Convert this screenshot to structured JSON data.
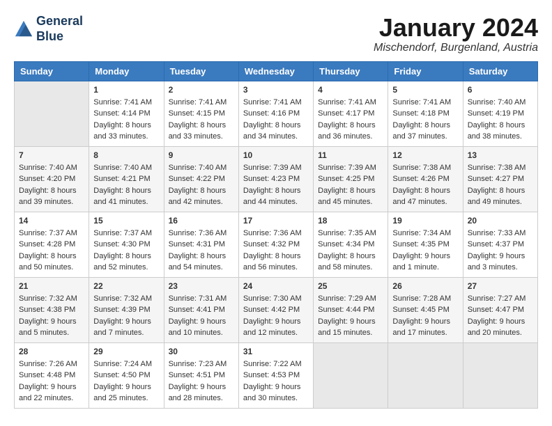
{
  "header": {
    "logo_line1": "General",
    "logo_line2": "Blue",
    "month": "January 2024",
    "location": "Mischendorf, Burgenland, Austria"
  },
  "weekdays": [
    "Sunday",
    "Monday",
    "Tuesday",
    "Wednesday",
    "Thursday",
    "Friday",
    "Saturday"
  ],
  "weeks": [
    [
      {
        "day": "",
        "sunrise": "",
        "sunset": "",
        "daylight": ""
      },
      {
        "day": "1",
        "sunrise": "Sunrise: 7:41 AM",
        "sunset": "Sunset: 4:14 PM",
        "daylight": "Daylight: 8 hours and 33 minutes."
      },
      {
        "day": "2",
        "sunrise": "Sunrise: 7:41 AM",
        "sunset": "Sunset: 4:15 PM",
        "daylight": "Daylight: 8 hours and 33 minutes."
      },
      {
        "day": "3",
        "sunrise": "Sunrise: 7:41 AM",
        "sunset": "Sunset: 4:16 PM",
        "daylight": "Daylight: 8 hours and 34 minutes."
      },
      {
        "day": "4",
        "sunrise": "Sunrise: 7:41 AM",
        "sunset": "Sunset: 4:17 PM",
        "daylight": "Daylight: 8 hours and 36 minutes."
      },
      {
        "day": "5",
        "sunrise": "Sunrise: 7:41 AM",
        "sunset": "Sunset: 4:18 PM",
        "daylight": "Daylight: 8 hours and 37 minutes."
      },
      {
        "day": "6",
        "sunrise": "Sunrise: 7:40 AM",
        "sunset": "Sunset: 4:19 PM",
        "daylight": "Daylight: 8 hours and 38 minutes."
      }
    ],
    [
      {
        "day": "7",
        "sunrise": "Sunrise: 7:40 AM",
        "sunset": "Sunset: 4:20 PM",
        "daylight": "Daylight: 8 hours and 39 minutes."
      },
      {
        "day": "8",
        "sunrise": "Sunrise: 7:40 AM",
        "sunset": "Sunset: 4:21 PM",
        "daylight": "Daylight: 8 hours and 41 minutes."
      },
      {
        "day": "9",
        "sunrise": "Sunrise: 7:40 AM",
        "sunset": "Sunset: 4:22 PM",
        "daylight": "Daylight: 8 hours and 42 minutes."
      },
      {
        "day": "10",
        "sunrise": "Sunrise: 7:39 AM",
        "sunset": "Sunset: 4:23 PM",
        "daylight": "Daylight: 8 hours and 44 minutes."
      },
      {
        "day": "11",
        "sunrise": "Sunrise: 7:39 AM",
        "sunset": "Sunset: 4:25 PM",
        "daylight": "Daylight: 8 hours and 45 minutes."
      },
      {
        "day": "12",
        "sunrise": "Sunrise: 7:38 AM",
        "sunset": "Sunset: 4:26 PM",
        "daylight": "Daylight: 8 hours and 47 minutes."
      },
      {
        "day": "13",
        "sunrise": "Sunrise: 7:38 AM",
        "sunset": "Sunset: 4:27 PM",
        "daylight": "Daylight: 8 hours and 49 minutes."
      }
    ],
    [
      {
        "day": "14",
        "sunrise": "Sunrise: 7:37 AM",
        "sunset": "Sunset: 4:28 PM",
        "daylight": "Daylight: 8 hours and 50 minutes."
      },
      {
        "day": "15",
        "sunrise": "Sunrise: 7:37 AM",
        "sunset": "Sunset: 4:30 PM",
        "daylight": "Daylight: 8 hours and 52 minutes."
      },
      {
        "day": "16",
        "sunrise": "Sunrise: 7:36 AM",
        "sunset": "Sunset: 4:31 PM",
        "daylight": "Daylight: 8 hours and 54 minutes."
      },
      {
        "day": "17",
        "sunrise": "Sunrise: 7:36 AM",
        "sunset": "Sunset: 4:32 PM",
        "daylight": "Daylight: 8 hours and 56 minutes."
      },
      {
        "day": "18",
        "sunrise": "Sunrise: 7:35 AM",
        "sunset": "Sunset: 4:34 PM",
        "daylight": "Daylight: 8 hours and 58 minutes."
      },
      {
        "day": "19",
        "sunrise": "Sunrise: 7:34 AM",
        "sunset": "Sunset: 4:35 PM",
        "daylight": "Daylight: 9 hours and 1 minute."
      },
      {
        "day": "20",
        "sunrise": "Sunrise: 7:33 AM",
        "sunset": "Sunset: 4:37 PM",
        "daylight": "Daylight: 9 hours and 3 minutes."
      }
    ],
    [
      {
        "day": "21",
        "sunrise": "Sunrise: 7:32 AM",
        "sunset": "Sunset: 4:38 PM",
        "daylight": "Daylight: 9 hours and 5 minutes."
      },
      {
        "day": "22",
        "sunrise": "Sunrise: 7:32 AM",
        "sunset": "Sunset: 4:39 PM",
        "daylight": "Daylight: 9 hours and 7 minutes."
      },
      {
        "day": "23",
        "sunrise": "Sunrise: 7:31 AM",
        "sunset": "Sunset: 4:41 PM",
        "daylight": "Daylight: 9 hours and 10 minutes."
      },
      {
        "day": "24",
        "sunrise": "Sunrise: 7:30 AM",
        "sunset": "Sunset: 4:42 PM",
        "daylight": "Daylight: 9 hours and 12 minutes."
      },
      {
        "day": "25",
        "sunrise": "Sunrise: 7:29 AM",
        "sunset": "Sunset: 4:44 PM",
        "daylight": "Daylight: 9 hours and 15 minutes."
      },
      {
        "day": "26",
        "sunrise": "Sunrise: 7:28 AM",
        "sunset": "Sunset: 4:45 PM",
        "daylight": "Daylight: 9 hours and 17 minutes."
      },
      {
        "day": "27",
        "sunrise": "Sunrise: 7:27 AM",
        "sunset": "Sunset: 4:47 PM",
        "daylight": "Daylight: 9 hours and 20 minutes."
      }
    ],
    [
      {
        "day": "28",
        "sunrise": "Sunrise: 7:26 AM",
        "sunset": "Sunset: 4:48 PM",
        "daylight": "Daylight: 9 hours and 22 minutes."
      },
      {
        "day": "29",
        "sunrise": "Sunrise: 7:24 AM",
        "sunset": "Sunset: 4:50 PM",
        "daylight": "Daylight: 9 hours and 25 minutes."
      },
      {
        "day": "30",
        "sunrise": "Sunrise: 7:23 AM",
        "sunset": "Sunset: 4:51 PM",
        "daylight": "Daylight: 9 hours and 28 minutes."
      },
      {
        "day": "31",
        "sunrise": "Sunrise: 7:22 AM",
        "sunset": "Sunset: 4:53 PM",
        "daylight": "Daylight: 9 hours and 30 minutes."
      },
      {
        "day": "",
        "sunrise": "",
        "sunset": "",
        "daylight": ""
      },
      {
        "day": "",
        "sunrise": "",
        "sunset": "",
        "daylight": ""
      },
      {
        "day": "",
        "sunrise": "",
        "sunset": "",
        "daylight": ""
      }
    ]
  ]
}
